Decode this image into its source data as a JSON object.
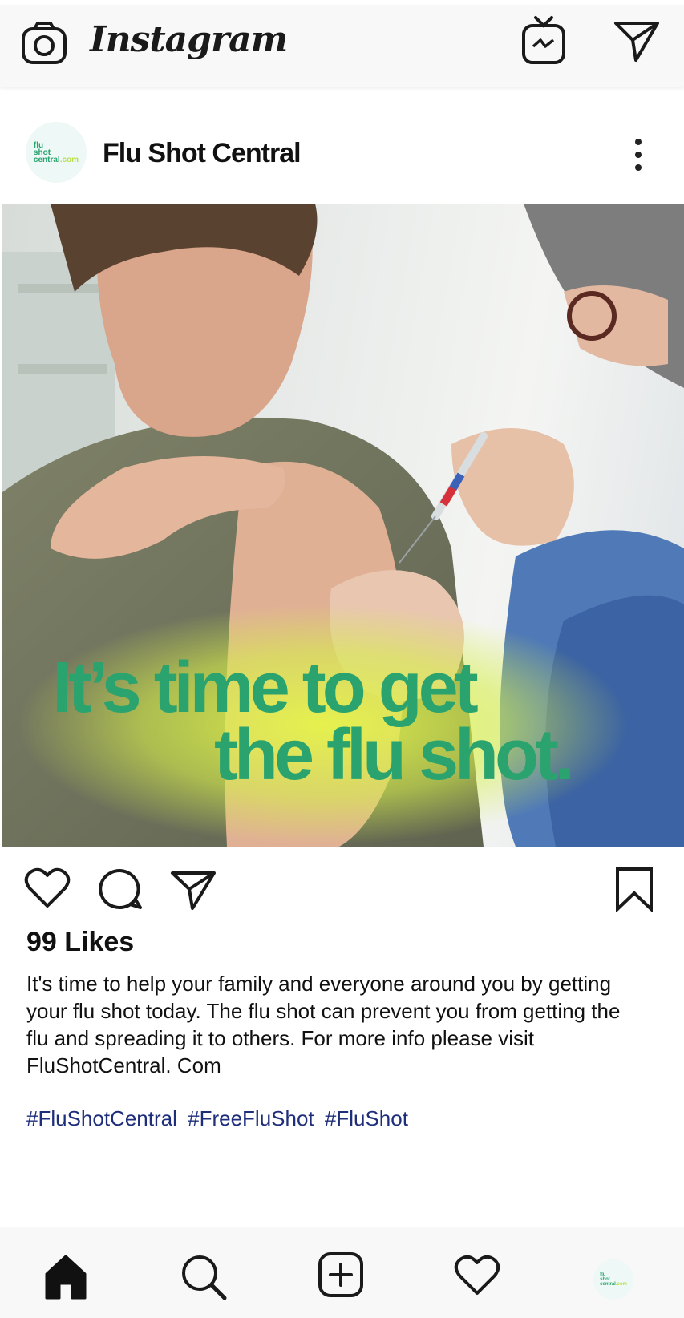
{
  "app": {
    "name": "Instagram",
    "icons": {
      "camera": "camera-icon",
      "igtv": "tv-icon",
      "direct": "send-icon"
    }
  },
  "post": {
    "account_name": "Flu Shot Central",
    "avatar_logo": [
      "flu",
      "shot",
      "central",
      ".com"
    ],
    "image": {
      "headline_line1": "It’s time to get",
      "headline_line2": "the flu shot."
    },
    "likes": "99 Likes",
    "caption_lines": [
      "It's time to help your family and everyone around you by getting",
      "your flu shot today. The flu shot can prevent you from getting the",
      "flu and spreading it to others. For more info please visit",
      "FluShotCentral. Com"
    ],
    "hashtags": [
      "#FluShotCentral",
      "#FreeFluShot",
      "#FluShot"
    ]
  },
  "colors": {
    "headline_green": "#2aa36f",
    "hashtag_blue": "#1f2e7a",
    "glow_yellow": "#d6ef4a"
  },
  "bottom_nav": {
    "items": [
      "home-icon",
      "search-icon",
      "add-post-icon",
      "activity-icon",
      "profile-avatar"
    ]
  }
}
